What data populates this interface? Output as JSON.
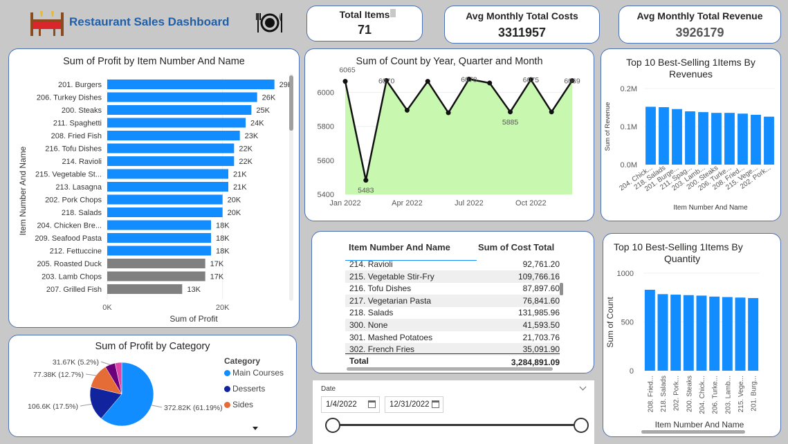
{
  "header": {
    "title": "Restaurant Sales Dashboard"
  },
  "kpis": {
    "total_items_label": "Total Items",
    "total_items_value": "71",
    "avg_cost_label": "Avg Monthly Total Costs",
    "avg_cost_value": "3311957",
    "avg_revenue_label": "Avg Monthly Total Revenue",
    "avg_revenue_value": "3926179"
  },
  "profit_chart": {
    "title": "Sum of Profit by Item Number And Name",
    "ylabel": "Item Number And Name",
    "xlabel": "Sum of Profit",
    "xticks": [
      "0K",
      "20K"
    ]
  },
  "count_chart": {
    "title": "Sum of Count by Year, Quarter and Month",
    "yticks": [
      "6000",
      "5800",
      "5600",
      "5400"
    ],
    "xticks": [
      "Jan 2022",
      "Apr 2022",
      "Jul 2022",
      "Oct 2022"
    ]
  },
  "rev_chart": {
    "title_line1": "Top 10 Best-Selling 1Items By",
    "title_line2": "Revenues",
    "ylabel": "Sum of Revenue",
    "xlabel": "Item Number And Name",
    "yticks": [
      "0.2M",
      "0.1M",
      "0.0M"
    ]
  },
  "qty_chart": {
    "title_line1": "Top 10 Best-Selling 1Items By",
    "title_line2": "Quantity",
    "ylabel": "Sum of Count",
    "xlabel": "Item Number And Name",
    "yticks": [
      "1000",
      "500",
      "0"
    ]
  },
  "pie_chart": {
    "title": "Sum of Profit by Category",
    "legend_title": "Category"
  },
  "table": {
    "col1": "Item Number And Name",
    "col2": "Sum of Cost Total",
    "rows": [
      [
        "214. Ravioli",
        "92,761.20"
      ],
      [
        "215. Vegetable Stir-Fry",
        "109,766.16"
      ],
      [
        "216. Tofu Dishes",
        "87,897.60"
      ],
      [
        "217. Vegetarian Pasta",
        "76,841.60"
      ],
      [
        "218. Salads",
        "131,985.96"
      ],
      [
        "300. None",
        "41,593.50"
      ],
      [
        "301. Mashed Potatoes",
        "21,703.76"
      ],
      [
        "302. French Fries",
        "35,091.90"
      ]
    ],
    "total_label": "Total",
    "total_value": "3,284,891.09"
  },
  "date_slicer": {
    "label": "Date",
    "start": "1/4/2022",
    "end": "12/31/2022"
  },
  "colors": {
    "accent": "#118dff",
    "gray": "#808080",
    "area": "#c8f7b0"
  },
  "chart_data": [
    {
      "type": "bar",
      "orientation": "horizontal",
      "title": "Sum of Profit by Item Number And Name",
      "xlabel": "Sum of Profit",
      "ylabel": "Item Number And Name",
      "categories": [
        "201. Burgers",
        "206. Turkey Dishes",
        "200. Steaks",
        "211. Spaghetti",
        "208. Fried Fish",
        "216. Tofu Dishes",
        "214. Ravioli",
        "215. Vegetable St...",
        "213. Lasagna",
        "202. Pork Chops",
        "218. Salads",
        "204. Chicken Bre...",
        "209. Seafood Pasta",
        "212. Fettuccine",
        "205. Roasted Duck",
        "203. Lamb Chops",
        "207. Grilled Fish"
      ],
      "values": [
        29,
        26,
        25,
        24,
        23,
        22,
        22,
        21,
        21,
        20,
        20,
        18,
        18,
        18,
        17,
        17,
        13
      ],
      "labels": [
        "29K",
        "26K",
        "25K",
        "24K",
        "23K",
        "22K",
        "22K",
        "21K",
        "21K",
        "20K",
        "20K",
        "18K",
        "18K",
        "18K",
        "17K",
        "17K",
        "13K"
      ],
      "highlighted_count": 14,
      "xlim": [
        0,
        30
      ]
    },
    {
      "type": "area",
      "title": "Sum of Count by Year, Quarter and Month",
      "x": [
        "Jan 2022",
        "Feb 2022",
        "Mar 2022",
        "Apr 2022",
        "May 2022",
        "Jun 2022",
        "Jul 2022",
        "Aug 2022",
        "Sep 2022",
        "Oct 2022",
        "Nov 2022",
        "Dec 2022"
      ],
      "values": [
        6065,
        5483,
        6070,
        5895,
        6065,
        5880,
        6078,
        6055,
        5885,
        6075,
        5885,
        6069
      ],
      "point_labels": [
        "6065",
        "5483",
        "6070",
        "",
        "",
        "",
        "6078",
        "",
        "5885",
        "6075",
        "",
        "6069"
      ],
      "ylim": [
        5400,
        6100
      ]
    },
    {
      "type": "bar",
      "title": "Top 10 Best-Selling 1Items By Revenues",
      "xlabel": "Item Number And Name",
      "ylabel": "Sum of Revenue",
      "categories": [
        "204. Chick...",
        "218. Salads",
        "201. Burge...",
        "211. Spag...",
        "203. Lamb...",
        "200. Steaks",
        "206. Turke...",
        "208. Fried...",
        "215. Vege...",
        "202. Pork..."
      ],
      "values": [
        0.152,
        0.151,
        0.146,
        0.14,
        0.138,
        0.136,
        0.136,
        0.134,
        0.131,
        0.126
      ],
      "ylim": [
        0,
        0.2
      ]
    },
    {
      "type": "bar",
      "title": "Top 10 Best-Selling 1Items By Quantity",
      "xlabel": "Item Number And Name",
      "ylabel": "Sum of Count",
      "categories": [
        "208. Fried...",
        "218. Salads",
        "202. Pork...",
        "200. Steaks",
        "204. Chick...",
        "206. Turke...",
        "203. Lamb...",
        "215. Vege...",
        "201. Burg..."
      ],
      "values": [
        830,
        785,
        780,
        775,
        770,
        760,
        755,
        750,
        745
      ],
      "ylim": [
        0,
        1000
      ]
    },
    {
      "type": "pie",
      "title": "Sum of Profit by Category",
      "legend_title": "Category",
      "legend": [
        "Main Courses",
        "Desserts",
        "Sides"
      ],
      "slices": [
        {
          "label": "372.82K (61.19%)",
          "value": 61.19,
          "color": "#118dff"
        },
        {
          "label": "106.6K (17.5%)",
          "value": 17.5,
          "color": "#12239e"
        },
        {
          "label": "77.38K (12.7%)",
          "value": 12.7,
          "color": "#e66c37"
        },
        {
          "label": "31.67K (5.2%)",
          "value": 5.2,
          "color": "#6b007b"
        },
        {
          "label": "",
          "value": 3.41,
          "color": "#e044a7"
        }
      ],
      "legend_colors": [
        "#118dff",
        "#12239e",
        "#e66c37"
      ]
    }
  ]
}
